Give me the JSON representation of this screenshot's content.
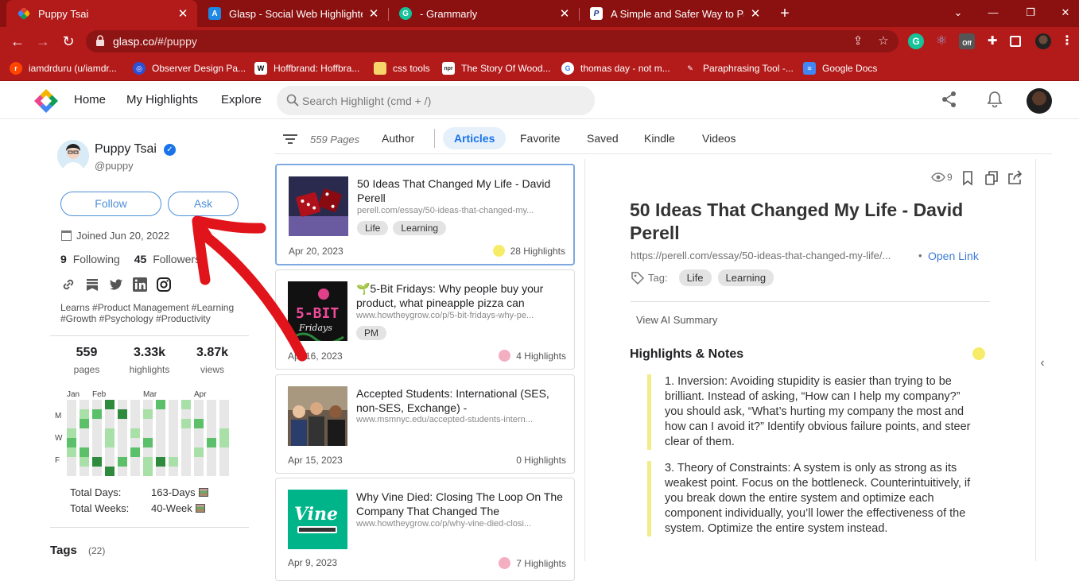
{
  "browser": {
    "tabs": [
      {
        "title": "Puppy Tsai",
        "favicon": "glasp-logo-icon",
        "active": true
      },
      {
        "title": "Glasp - Social Web Highlighter or",
        "favicon": "app-store-icon",
        "active": false
      },
      {
        "title": "- Grammarly",
        "favicon": "grammarly-icon",
        "active": false
      },
      {
        "title": "A Simple and Safer Way to Pay ar",
        "favicon": "paypal-icon",
        "active": false
      }
    ],
    "url_host": "glasp.co",
    "url_path": "/#/puppy",
    "extension_badge": "Off",
    "bookmarks": [
      {
        "label": "iamdrduru (u/iamdr...",
        "icon": "reddit-icon"
      },
      {
        "label": "Observer Design Pa...",
        "icon": "observer-icon"
      },
      {
        "label": "Hoffbrand: Hoffbra...",
        "icon": "wiley-icon"
      },
      {
        "label": "css tools",
        "icon": "folder-icon"
      },
      {
        "label": "The Story Of Wood...",
        "icon": "npr-icon"
      },
      {
        "label": "thomas day - not m...",
        "icon": "google-icon"
      },
      {
        "label": "Paraphrasing Tool -...",
        "icon": "quill-icon"
      },
      {
        "label": "Google Docs",
        "icon": "docs-icon"
      }
    ]
  },
  "appbar": {
    "nav": [
      "Home",
      "My Highlights",
      "Explore"
    ],
    "search_placeholder": "Search Highlight (cmd + /)"
  },
  "profile": {
    "name": "Puppy Tsai",
    "handle": "@puppy",
    "follow_label": "Follow",
    "ask_label": "Ask",
    "joined": "Joined Jun 20, 2022",
    "following_count": "9",
    "following_label": "Following",
    "followers_count": "45",
    "followers_label": "Followers",
    "bio": "Learns #Product Management #Learning #Growth #Psychology #Productivity",
    "stats": [
      {
        "value": "559",
        "label": "pages"
      },
      {
        "value": "3.33k",
        "label": "highlights"
      },
      {
        "value": "3.87k",
        "label": "views"
      }
    ],
    "heatmap_months": [
      "Jan",
      "Feb",
      "Mar",
      "Apr"
    ],
    "heatmap_days": [
      "M",
      "W",
      "F"
    ],
    "total_days_label": "Total Days:",
    "total_days_value": "163-Days",
    "total_weeks_label": "Total Weeks:",
    "total_weeks_value": "40-Week",
    "tags_label": "Tags",
    "tags_count": "(22)"
  },
  "list": {
    "page_count": "559 Pages",
    "filters": [
      "Author",
      "Articles",
      "Favorite",
      "Saved",
      "Kindle",
      "Videos"
    ],
    "active_filter": "Articles",
    "cards": [
      {
        "title": "50 Ideas That Changed My Life - David Perell",
        "url": "perell.com/essay/50-ideas-that-changed-my...",
        "tags": [
          "Life",
          "Learning"
        ],
        "date": "Apr 20, 2023",
        "highlights": "28 Highlights",
        "dot": "#f6ec68"
      },
      {
        "title": "🌱5-Bit Fridays: Why people buy your product, what pineapple pizza can",
        "url": "www.howtheygrow.co/p/5-bit-fridays-why-pe...",
        "tags": [
          "PM"
        ],
        "date": "Apr 16, 2023",
        "highlights": "4 Highlights",
        "dot": "#f4aec1"
      },
      {
        "title": "Accepted Students: International (SES, non-SES, Exchange) -",
        "url": "www.msmnyc.edu/accepted-students-intern...",
        "tags": [],
        "date": "Apr 15, 2023",
        "highlights": "0 Highlights",
        "dot": ""
      },
      {
        "title": "Why Vine Died: Closing The Loop On The Company That Changed The",
        "url": "www.howtheygrow.co/p/why-vine-died-closi...",
        "tags": [],
        "date": "Apr 9, 2023",
        "highlights": "7 Highlights",
        "dot": "#f4aec1"
      }
    ]
  },
  "detail": {
    "views": "9",
    "title": "50 Ideas That Changed My Life - David Perell",
    "url": "https://perell.com/essay/50-ideas-that-changed-my-life/...",
    "open_link": "Open Link",
    "tag_label": "Tag:",
    "tags": [
      "Life",
      "Learning"
    ],
    "ai_summary": "View AI Summary",
    "section_title": "Highlights & Notes",
    "notes": [
      "1. Inversion: Avoiding stupidity is easier than trying to be brilliant. Instead of asking, “How can I help my company?” you should ask, “What’s hurting my company the most and how can I avoid it?” Identify obvious failure points, and steer clear of them.",
      "3. Theory of Constraints: A system is only as strong as its weakest point. Focus on the bottleneck. Counterintuitively, if you break down the entire system and optimize each component individually, you’ll lower the effectiveness of the system. Optimize the entire system instead."
    ]
  },
  "colors": {
    "chrome_dark": "#8b1010",
    "chrome": "#b31b1b",
    "accent_blue": "#1a73e8",
    "highlight_yellow": "#f6ec68",
    "annotation_red": "#e0141a"
  }
}
